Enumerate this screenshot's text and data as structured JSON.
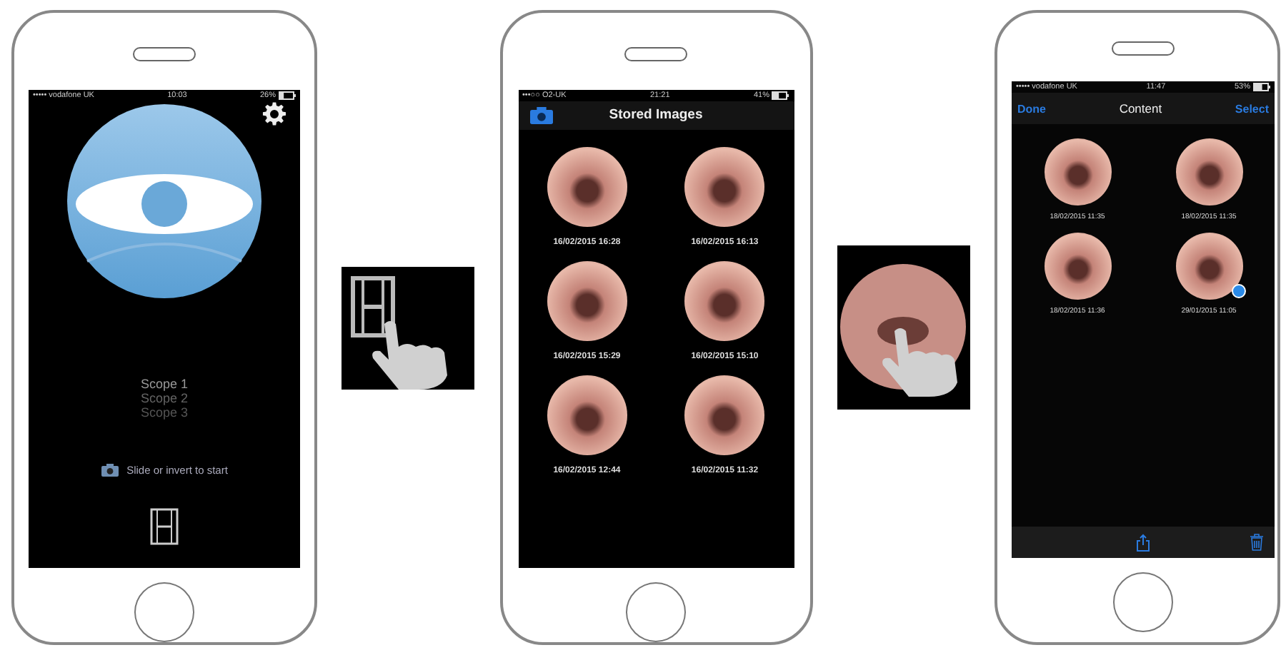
{
  "home_screen": {
    "status_bar": {
      "carrier": "••••• vodafone UK",
      "time": "10:03",
      "battery": "26%"
    },
    "scopes": [
      {
        "label": "Scope 1",
        "selected": true
      },
      {
        "label": "Scope 2",
        "selected": false
      },
      {
        "label": "Scope 3",
        "selected": false
      }
    ],
    "hint": "Slide or invert to start"
  },
  "stored_images_screen": {
    "status_bar": {
      "carrier": "•••○○ O2-UK",
      "time": "21:21",
      "battery": "41%"
    },
    "title": "Stored Images",
    "images": [
      {
        "date": "16/02/2015 16:28"
      },
      {
        "date": "16/02/2015 16:13"
      },
      {
        "date": "16/02/2015 15:29"
      },
      {
        "date": "16/02/2015 15:10"
      },
      {
        "date": "16/02/2015 12:44"
      },
      {
        "date": "16/02/2015 11:32"
      }
    ]
  },
  "content_screen": {
    "status_bar": {
      "carrier": "••••• vodafone UK",
      "time": "11:47",
      "battery": "53%"
    },
    "left_button": "Done",
    "title": "Content",
    "right_button": "Select",
    "items": [
      {
        "date": "18/02/2015 11:35",
        "video": false
      },
      {
        "date": "18/02/2015 11:35",
        "video": false
      },
      {
        "date": "18/02/2015 11:36",
        "video": false
      },
      {
        "date": "29/01/2015 11:05",
        "video": true
      }
    ]
  }
}
